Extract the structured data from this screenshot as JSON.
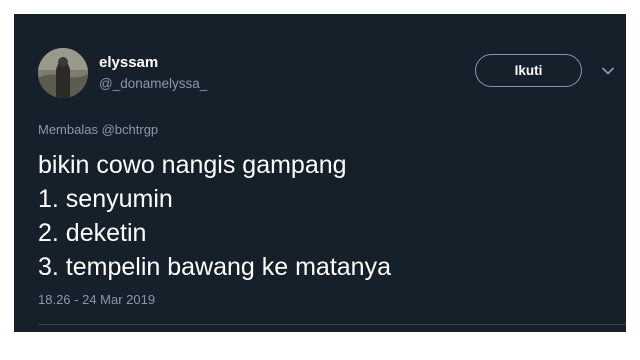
{
  "tweet": {
    "display_name": "elyssam",
    "handle": "@_donamelyssa_",
    "follow_label": "Ikuti",
    "reply_prefix": "Membalas",
    "reply_to": "@bchtrgp",
    "lines": [
      "bikin cowo nangis gampang",
      "1. senyumin",
      "2. deketin",
      "3. tempelin bawang ke matanya"
    ],
    "timestamp": "18.26 - 24 Mar 2019"
  },
  "icons": {
    "avatar": "profile-photo",
    "more": "chevron-down-icon"
  },
  "colors": {
    "background": "#15202b",
    "text": "#ffffff",
    "secondary_text": "#8899a6",
    "divider": "#38444d"
  }
}
